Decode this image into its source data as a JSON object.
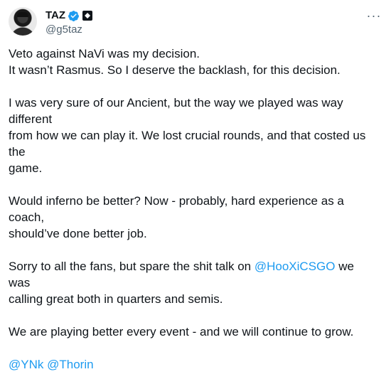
{
  "author": {
    "display_name": "TAZ",
    "handle": "@g5taz",
    "verified_color": "#1d9bf0"
  },
  "header": {
    "more_icon": "···"
  },
  "tweet": {
    "p1_line1": "Veto against NaVi was my decision.",
    "p1_line2": "It wasn’t Rasmus. So I deserve the backlash, for this decision.",
    "p2_line1": "I was very sure of our Ancient, but the way we played was way different",
    "p2_line2": "from how we can play it. We lost crucial rounds, and that costed us the",
    "p2_line3": "game.",
    "p3_line1": "Would inferno be better? Now - probably, hard experience as a coach,",
    "p3_line2": "should’ve done better job.",
    "p4_line1_pre": "Sorry to all the fans, but spare the shit talk on ",
    "p4_mention": "@HooXiCSGO",
    "p4_line1_post": " we was",
    "p4_line2": "calling great both in quarters and semis.",
    "p5": "We are playing better every event - and we will continue to grow.",
    "mention1": "@YNk",
    "mention2": "@Thorin"
  },
  "colors": {
    "text": "#0f1419",
    "secondary": "#536471",
    "link": "#1d9bf0"
  }
}
